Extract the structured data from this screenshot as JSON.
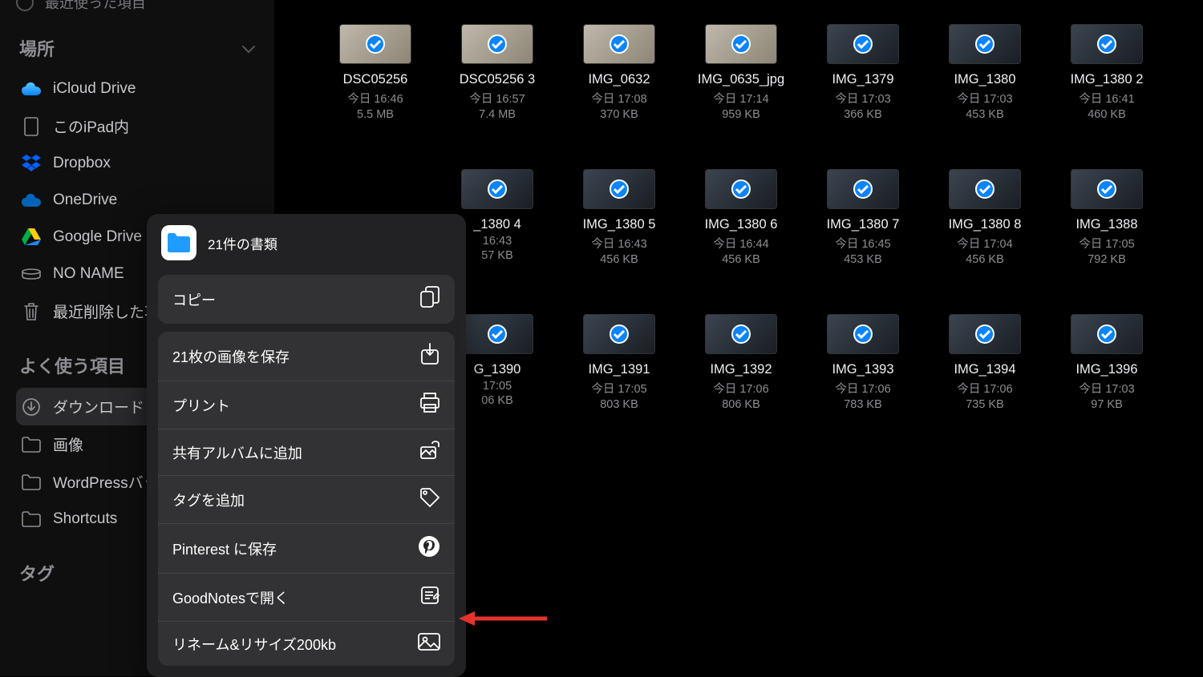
{
  "sidebar": {
    "recent_label": "最近使った項目",
    "locations_header": "場所",
    "locations": [
      {
        "label": "iCloud Drive",
        "icon": "cloud"
      },
      {
        "label": "このiPad内",
        "icon": "ipad"
      },
      {
        "label": "Dropbox",
        "icon": "dropbox"
      },
      {
        "label": "OneDrive",
        "icon": "onedrive"
      },
      {
        "label": "Google Drive",
        "icon": "gdrive"
      },
      {
        "label": "NO NAME",
        "icon": "disk"
      },
      {
        "label": "最近削除した項",
        "icon": "trash"
      }
    ],
    "favorites_header": "よく使う項目",
    "favorites": [
      {
        "label": "ダウンロード",
        "icon": "download",
        "active": true
      },
      {
        "label": "画像",
        "icon": "folder"
      },
      {
        "label": "WordPressバッ",
        "icon": "folder"
      },
      {
        "label": "Shortcuts",
        "icon": "folder"
      }
    ],
    "tags_header": "タグ"
  },
  "files": [
    {
      "name": "DSC05256",
      "date": "今日 16:46",
      "size": "5.5 MB",
      "light": true
    },
    {
      "name": "DSC05256 3",
      "date": "今日 16:57",
      "size": "7.4 MB",
      "light": true
    },
    {
      "name": "IMG_0632",
      "date": "今日 17:08",
      "size": "370 KB",
      "light": true
    },
    {
      "name": "IMG_0635_jpg",
      "date": "今日 17:14",
      "size": "959 KB",
      "light": true
    },
    {
      "name": "IMG_1379",
      "date": "今日 17:03",
      "size": "366 KB"
    },
    {
      "name": "IMG_1380",
      "date": "今日 17:03",
      "size": "453 KB"
    },
    {
      "name": "IMG_1380 2",
      "date": "今日 16:41",
      "size": "460 KB"
    },
    {
      "name": "",
      "date": "",
      "size": ""
    },
    {
      "name": "_1380 4",
      "date": "16:43",
      "size": "57 KB"
    },
    {
      "name": "IMG_1380 5",
      "date": "今日 16:43",
      "size": "456 KB"
    },
    {
      "name": "IMG_1380 6",
      "date": "今日 16:44",
      "size": "456 KB"
    },
    {
      "name": "IMG_1380 7",
      "date": "今日 16:45",
      "size": "453 KB"
    },
    {
      "name": "IMG_1380 8",
      "date": "今日 17:04",
      "size": "456 KB"
    },
    {
      "name": "IMG_1388",
      "date": "今日 17:05",
      "size": "792 KB"
    },
    {
      "name": "",
      "date": "",
      "size": ""
    },
    {
      "name": "G_1390",
      "date": "17:05",
      "size": "06 KB"
    },
    {
      "name": "IMG_1391",
      "date": "今日 17:05",
      "size": "803 KB"
    },
    {
      "name": "IMG_1392",
      "date": "今日 17:06",
      "size": "806 KB"
    },
    {
      "name": "IMG_1393",
      "date": "今日 17:06",
      "size": "783 KB"
    },
    {
      "name": "IMG_1394",
      "date": "今日 17:06",
      "size": "735 KB"
    },
    {
      "name": "IMG_1396",
      "date": "今日 17:03",
      "size": "97 KB"
    }
  ],
  "share": {
    "title": "21件の書類",
    "actions": [
      {
        "label": "コピー",
        "icon": "copy"
      },
      {
        "label": "21枚の画像を保存",
        "icon": "save"
      },
      {
        "label": "プリント",
        "icon": "print"
      },
      {
        "label": "共有アルバムに追加",
        "icon": "album"
      },
      {
        "label": "タグを追加",
        "icon": "tag"
      },
      {
        "label": "Pinterest に保存",
        "icon": "pinterest"
      },
      {
        "label": "GoodNotesで開く",
        "icon": "goodnotes"
      },
      {
        "label": "リネーム&リサイズ200kb",
        "icon": "image"
      }
    ]
  }
}
